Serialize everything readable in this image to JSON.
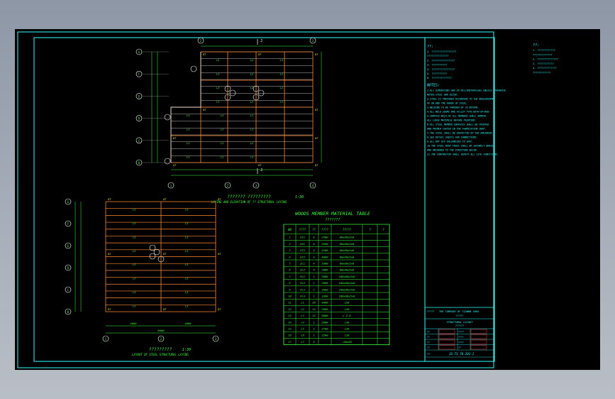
{
  "window": {
    "title": ""
  },
  "plan_upper": {
    "title": "??????? ?????????",
    "subtitle": "LAYING AND ELEVATION OF ?? STRUCTURAL LAYING",
    "scale": "1:30",
    "grid_top": [
      "2",
      "3"
    ],
    "grid_bottom": [
      "1",
      "2",
      "3",
      "4"
    ],
    "grid_left": [
      "G",
      "F",
      "E",
      "D",
      "C",
      "B"
    ],
    "section_mark": "J",
    "column_tag": "GT",
    "beam_tag": "L2"
  },
  "plan_lower": {
    "title": "?????????",
    "subtitle": "LAYOUT OF STEEL STRUCTURAL LAYING",
    "scale": "1:30",
    "grid_left": [
      "G",
      "F",
      "E",
      "D",
      "C",
      "B"
    ],
    "grid_bottom": [
      "1",
      "2",
      "3"
    ],
    "column_tag": "GT",
    "beam_tag": "L3",
    "dim_bottom": [
      "4000",
      "4000",
      "8000"
    ]
  },
  "material_table": {
    "title": "WOODS MEMBER MATERIAL TABLE",
    "subtitle": "???????",
    "headers": [
      "NO",
      "????",
      "??",
      "????",
      "?????",
      "?",
      "?"
    ],
    "rows": [
      [
        "1",
        "GT1",
        "8",
        "2500",
        "80x80x5x8"
      ],
      [
        "2",
        "GZ1",
        "4",
        "2500",
        "80x80x5x8"
      ],
      [
        "3",
        "GT2",
        "4",
        "2500",
        "80x80x5x8"
      ],
      [
        "4",
        "GT3",
        "4",
        "4000",
        "80x80x5x8"
      ],
      [
        "5",
        "ZL1",
        "4",
        "3500",
        "80x80x5x8"
      ],
      [
        "6",
        "ZL2",
        "4",
        "3000",
        "80x80x5x8"
      ],
      [
        "7",
        "PL1",
        "1",
        "2000",
        "160x80x5x8"
      ],
      [
        "8",
        "PL2",
        "1",
        "2000",
        "160x80x5x8"
      ],
      [
        "9",
        "PL3",
        "1",
        "2000",
        "160x80x5x8"
      ],
      [
        "10",
        "PL4",
        "1",
        "1800",
        "160x80x5x8"
      ],
      [
        "11",
        "L1",
        "16",
        "4000",
        "L50"
      ],
      [
        "12",
        "L2",
        "14",
        "3800",
        "L50"
      ],
      [
        "13",
        "L3",
        "12",
        "6000",
        "L 2.8"
      ],
      [
        "14",
        "L4",
        "1",
        "2000",
        "L50"
      ],
      [
        "15",
        "L5",
        "2",
        "3700",
        "L50"
      ],
      [
        "16",
        "L6",
        "1",
        "2500",
        "L50"
      ],
      [
        "17",
        "L7",
        "5",
        "",
        "-80x80"
      ]
    ]
  },
  "notes": {
    "head1": "??:",
    "lines1": [
      "1. ????????????????",
      "   ??????????????",
      "2. ???????????????",
      "3. ??????????",
      "4. ???????????????",
      "5. ??????????",
      "6. ?????????????"
    ],
    "head2": "NOTES:",
    "lines2": [
      "1.ALL DIMENSIONS ARE IN MILLIMETERS(mm) UNLESS OTHERWISE",
      "  NOTED.STEEL ARE Q235B.",
      "2.STEEL IS PREPARED ACCORDING TO THE REQUIREMENT",
      "  OF GB AND THE GRADE OF STEEL.",
      "3.WELDING TO BE THROUGH BY CE METHOD.",
      "4.ALL WELD SEAMS ARE FILLET TYPE WITH HF=6mm",
      "5.SURFACE WELD OF ALL MEMBERS SHALL REMOVE",
      "  ALL LOOSE MATERIAL BEFORE PAINTING.",
      "6.ALL STEEL MEMBER SURFACES SHALL BE PAINTED",
      "  AND PRIMER COATED IN THE FABRICATION SHOP.",
      "7.THE STEEL SHALL BE INSPECTED BY THE ENGINEER.",
      "8.SEE DETAIL SHEETS FOR CONNECTIONS.",
      "9.ALL HOT DIP GALVANIZED TO SPEC.",
      "10.THE STEEL ROOF TRUSS SHALL BE SECURELY BRACED",
      "   AND ANCHORED TO THE STRUCTURE BELOW.",
      "11.THE CONTRACTOR SHALL VERIFY ALL SITE CONDITIONS."
    ]
  },
  "outer_notes": {
    "head": "??:",
    "lines": [
      "1. ????????????",
      "   ?????????????",
      "2. ??????????????",
      "3. ???????????",
      "4. ?????????????",
      "   ????????????"
    ]
  },
  "title_block": {
    "company_label": "?????",
    "company": "THE COMPANY OF TIANMA SHED",
    "company_sub": "?????",
    "drawing_name": "STRUCTURAL LAYOUT",
    "drawing_sub": "??????",
    "drawing_no": "JG-TS-70-201-1",
    "stage_label": "??",
    "rows": [
      [
        "??",
        "",
        "????",
        ""
      ],
      [
        "??",
        "",
        "????",
        ""
      ],
      [
        "??",
        "",
        "????",
        ""
      ],
      [
        "??",
        "",
        "??",
        ""
      ]
    ]
  }
}
